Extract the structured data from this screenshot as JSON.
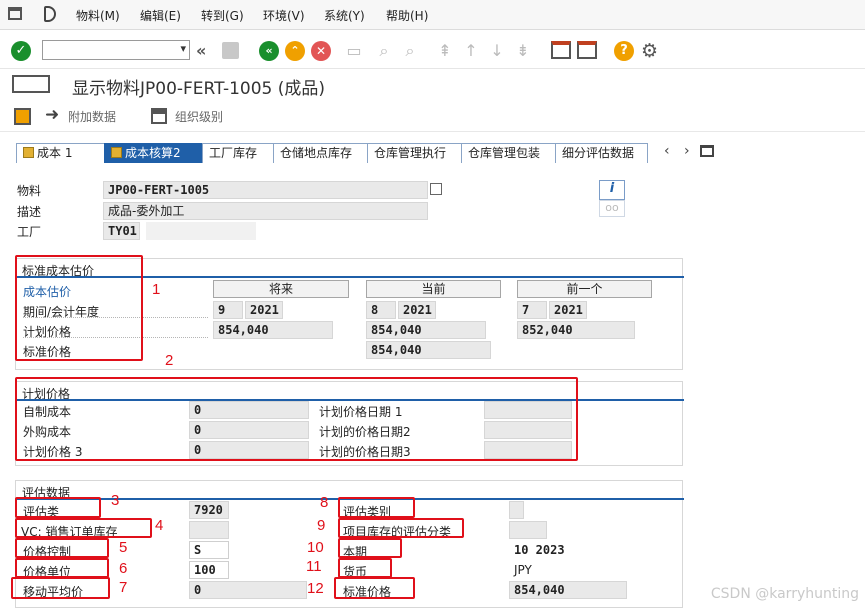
{
  "menu": {
    "items": [
      "物料(M)",
      "编辑(E)",
      "转到(G)",
      "环境(V)",
      "系统(Y)",
      "帮助(H)"
    ]
  },
  "title": {
    "text": "显示物料JP00-FERT-1005 (成品)"
  },
  "app_toolbar": {
    "additional_data": "附加数据",
    "org_levels": "组织级别"
  },
  "tabs": [
    "成本 1",
    "成本核算2",
    "工厂库存",
    "仓储地点库存",
    "仓库管理执行",
    "仓库管理包装",
    "细分评估数据"
  ],
  "header": {
    "material_label": "物料",
    "material_value": "JP00-FERT-1005",
    "desc_label": "描述",
    "desc_value": "成品-委外加工",
    "plant_label": "工厂",
    "plant_value": "TY01"
  },
  "std_cost": {
    "title": "标准成本估价",
    "col_future": "将来",
    "col_current": "当前",
    "col_previous": "前一个",
    "row_estimate": "成本估价",
    "row_period": "期间/会计年度",
    "row_planned": "计划价格",
    "row_standard": "标准价格",
    "future_period": "9",
    "future_year": "2021",
    "future_planned": "854,040",
    "current_period": "8",
    "current_year": "2021",
    "current_planned": "854,040",
    "current_standard": "854,040",
    "prev_period": "7",
    "prev_year": "2021",
    "prev_planned": "852,040"
  },
  "planned_price": {
    "title": "计划价格",
    "own_cost_label": "自制成本",
    "own_cost_value": "0",
    "purchased_label": "外购成本",
    "purchased_value": "0",
    "planned3_label": "计划价格 3",
    "planned3_value": "0",
    "date1_label": "计划价格日期 1",
    "date2_label": "计划的价格日期2",
    "date3_label": "计划的价格日期3"
  },
  "valuation": {
    "title": "评估数据",
    "class_label": "评估类",
    "class_value": "7920",
    "vc_label": "VC: 销售订单库存",
    "price_ctrl_label": "价格控制",
    "price_ctrl_value": "S",
    "price_unit_label": "价格单位",
    "price_unit_value": "100",
    "mov_avg_label": "移动平均价",
    "mov_avg_value": "0",
    "val_category_label": "评估类别",
    "proj_stock_label": "项目库存的评估分类",
    "period_label": "本期",
    "period_value": "10  2023",
    "currency_label": "货币",
    "currency_value": "JPY",
    "std_price_label": "标准价格",
    "std_price_value": "854,040"
  },
  "annotations": [
    "1",
    "2",
    "3",
    "4",
    "5",
    "6",
    "7",
    "8",
    "9",
    "10",
    "11",
    "12"
  ],
  "watermark": "CSDN @karryhunting",
  "colors": {
    "accent": "#1f5fa8",
    "annotation_red": "#e0101a",
    "ok_green": "#1a8f2d",
    "help_orange": "#f0a000"
  }
}
